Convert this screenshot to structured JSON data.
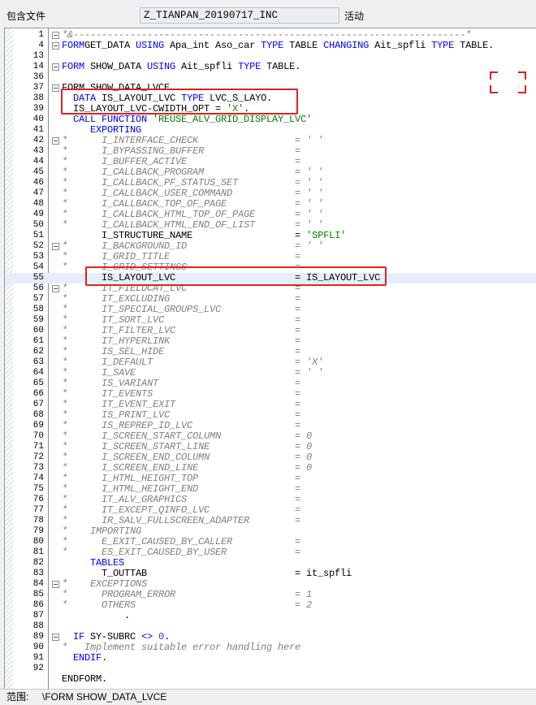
{
  "header": {
    "include_label": "包含文件",
    "program_name": "Z_TIANPAN_20190717_INC",
    "status": "活动"
  },
  "footer": {
    "scope_label": "范围:",
    "scope_value": "\\FORM SHOW_DATA_LVCE"
  },
  "editor": {
    "lines": [
      {
        "n": "1",
        "fold": true,
        "t": [
          [
            "cmt",
            "*&---------------------------------------------------------------------*"
          ]
        ]
      },
      {
        "n": "4",
        "fold": true,
        "t": [
          [
            "kw",
            "FORM"
          ],
          [
            "",
            "GET_DATA "
          ],
          [
            "kw",
            "USING"
          ],
          [
            "",
            " Apa_int Aso_car "
          ],
          [
            "kw",
            "TYPE"
          ],
          [
            "",
            " TABLE "
          ],
          [
            "kw",
            "CHANGING"
          ],
          [
            "",
            " Ait_spfli "
          ],
          [
            "kw",
            "TYPE"
          ],
          [
            "",
            " TABLE."
          ]
        ]
      },
      {
        "n": "13",
        "t": []
      },
      {
        "n": "14",
        "fold": true,
        "t": [
          [
            "kw",
            "FORM"
          ],
          [
            "",
            " SHOW_DATA "
          ],
          [
            "kw",
            "USING"
          ],
          [
            "",
            " Ait_spfli "
          ],
          [
            "kw",
            "TYPE"
          ],
          [
            "",
            " TABLE."
          ]
        ]
      },
      {
        "n": "36",
        "t": []
      },
      {
        "n": "37",
        "fold": true,
        "t": [
          [
            "",
            "FORM SHOW_DATA_LVCE."
          ]
        ]
      },
      {
        "n": "38",
        "t": [
          [
            "",
            "  "
          ],
          [
            "kw",
            "DATA"
          ],
          [
            "",
            " IS_LAYOUT_LVC "
          ],
          [
            "kw",
            "TYPE"
          ],
          [
            "",
            " LVC_S_LAYO."
          ]
        ]
      },
      {
        "n": "39",
        "t": [
          [
            "",
            "  IS_LAYOUT_LVC-CWIDTH_OPT = "
          ],
          [
            "str",
            "'X'"
          ],
          [
            "",
            "."
          ]
        ]
      },
      {
        "n": "40",
        "t": [
          [
            "",
            "  "
          ],
          [
            "kw",
            "CALL FUNCTION"
          ],
          [
            "str",
            " 'REUSE_ALV_GRID_DISPLAY_LVC'"
          ]
        ]
      },
      {
        "n": "41",
        "t": [
          [
            "kw",
            "     EXPORTING"
          ]
        ]
      },
      {
        "n": "42",
        "fold": true,
        "t": [
          [
            "cmt",
            "*      I_INTERFACE_CHECK                 = ' '"
          ]
        ]
      },
      {
        "n": "43",
        "t": [
          [
            "cmt",
            "*      I_BYPASSING_BUFFER                = "
          ]
        ]
      },
      {
        "n": "44",
        "t": [
          [
            "cmt",
            "*      I_BUFFER_ACTIVE                   = "
          ]
        ]
      },
      {
        "n": "45",
        "t": [
          [
            "cmt",
            "*      I_CALLBACK_PROGRAM                = ' '"
          ]
        ]
      },
      {
        "n": "46",
        "t": [
          [
            "cmt",
            "*      I_CALLBACK_PF_STATUS_SET          = ' '"
          ]
        ]
      },
      {
        "n": "47",
        "t": [
          [
            "cmt",
            "*      I_CALLBACK_USER_COMMAND           = ' '"
          ]
        ]
      },
      {
        "n": "48",
        "t": [
          [
            "cmt",
            "*      I_CALLBACK_TOP_OF_PAGE            = ' '"
          ]
        ]
      },
      {
        "n": "49",
        "t": [
          [
            "cmt",
            "*      I_CALLBACK_HTML_TOP_OF_PAGE       = ' '"
          ]
        ]
      },
      {
        "n": "50",
        "t": [
          [
            "cmt",
            "*      I_CALLBACK_HTML_END_OF_LIST       = ' '"
          ]
        ]
      },
      {
        "n": "51",
        "t": [
          [
            "",
            "       I_STRUCTURE_NAME                  = "
          ],
          [
            "str",
            "'SPFLI'"
          ]
        ]
      },
      {
        "n": "52",
        "fold": true,
        "t": [
          [
            "cmt",
            "*      I_BACKGROUND_ID                   = ' '"
          ]
        ]
      },
      {
        "n": "53",
        "t": [
          [
            "cmt",
            "*      I_GRID_TITLE                      = "
          ]
        ]
      },
      {
        "n": "54",
        "t": [
          [
            "cmt",
            "*      I_GRID_SETTINGS                   = "
          ]
        ]
      },
      {
        "n": "55",
        "hl": true,
        "t": [
          [
            "",
            "       IS_LAYOUT_LVC                     = IS_LAYOUT_LVC"
          ]
        ]
      },
      {
        "n": "56",
        "fold": true,
        "t": [
          [
            "cmt",
            "*      IT_FIELDCAT_LVC                   = "
          ]
        ]
      },
      {
        "n": "57",
        "t": [
          [
            "cmt",
            "*      IT_EXCLUDING                      = "
          ]
        ]
      },
      {
        "n": "58",
        "t": [
          [
            "cmt",
            "*      IT_SPECIAL_GROUPS_LVC             = "
          ]
        ]
      },
      {
        "n": "59",
        "t": [
          [
            "cmt",
            "*      IT_SORT_LVC                       = "
          ]
        ]
      },
      {
        "n": "60",
        "t": [
          [
            "cmt",
            "*      IT_FILTER_LVC                     = "
          ]
        ]
      },
      {
        "n": "61",
        "t": [
          [
            "cmt",
            "*      IT_HYPERLINK                      = "
          ]
        ]
      },
      {
        "n": "62",
        "t": [
          [
            "cmt",
            "*      IS_SEL_HIDE                       = "
          ]
        ]
      },
      {
        "n": "63",
        "t": [
          [
            "cmt",
            "*      I_DEFAULT                         = 'X'"
          ]
        ]
      },
      {
        "n": "64",
        "t": [
          [
            "cmt",
            "*      I_SAVE                            = ' '"
          ]
        ]
      },
      {
        "n": "65",
        "t": [
          [
            "cmt",
            "*      IS_VARIANT                        = "
          ]
        ]
      },
      {
        "n": "66",
        "t": [
          [
            "cmt",
            "*      IT_EVENTS                         = "
          ]
        ]
      },
      {
        "n": "67",
        "t": [
          [
            "cmt",
            "*      IT_EVENT_EXIT                     = "
          ]
        ]
      },
      {
        "n": "68",
        "t": [
          [
            "cmt",
            "*      IS_PRINT_LVC                      = "
          ]
        ]
      },
      {
        "n": "69",
        "t": [
          [
            "cmt",
            "*      IS_REPREP_ID_LVC                  = "
          ]
        ]
      },
      {
        "n": "70",
        "t": [
          [
            "cmt",
            "*      I_SCREEN_START_COLUMN             = 0"
          ]
        ]
      },
      {
        "n": "71",
        "t": [
          [
            "cmt",
            "*      I_SCREEN_START_LINE               = 0"
          ]
        ]
      },
      {
        "n": "72",
        "t": [
          [
            "cmt",
            "*      I_SCREEN_END_COLUMN               = 0"
          ]
        ]
      },
      {
        "n": "73",
        "t": [
          [
            "cmt",
            "*      I_SCREEN_END_LINE                 = 0"
          ]
        ]
      },
      {
        "n": "74",
        "t": [
          [
            "cmt",
            "*      I_HTML_HEIGHT_TOP                 = "
          ]
        ]
      },
      {
        "n": "75",
        "t": [
          [
            "cmt",
            "*      I_HTML_HEIGHT_END                 = "
          ]
        ]
      },
      {
        "n": "76",
        "t": [
          [
            "cmt",
            "*      IT_ALV_GRAPHICS                   = "
          ]
        ]
      },
      {
        "n": "77",
        "t": [
          [
            "cmt",
            "*      IT_EXCEPT_QINFO_LVC               = "
          ]
        ]
      },
      {
        "n": "78",
        "t": [
          [
            "cmt",
            "*      IR_SALV_FULLSCREEN_ADAPTER        = "
          ]
        ]
      },
      {
        "n": "79",
        "t": [
          [
            "cmt",
            "*    IMPORTING"
          ]
        ]
      },
      {
        "n": "80",
        "t": [
          [
            "cmt",
            "*      E_EXIT_CAUSED_BY_CALLER           = "
          ]
        ]
      },
      {
        "n": "81",
        "t": [
          [
            "cmt",
            "*      ES_EXIT_CAUSED_BY_USER            = "
          ]
        ]
      },
      {
        "n": "82",
        "t": [
          [
            "kw",
            "     TABLES"
          ]
        ]
      },
      {
        "n": "83",
        "t": [
          [
            "",
            "       T_OUTTAB                          = it_spfli"
          ]
        ]
      },
      {
        "n": "84",
        "fold": true,
        "t": [
          [
            "cmt",
            "*    EXCEPTIONS"
          ]
        ]
      },
      {
        "n": "85",
        "t": [
          [
            "cmt",
            "*      PROGRAM_ERROR                     = 1"
          ]
        ]
      },
      {
        "n": "86",
        "t": [
          [
            "cmt",
            "*      OTHERS                            = 2"
          ]
        ]
      },
      {
        "n": "87",
        "t": [
          [
            "",
            "           ."
          ]
        ]
      },
      {
        "n": "88",
        "t": []
      },
      {
        "n": "89",
        "fold": true,
        "t": [
          [
            "",
            "  "
          ],
          [
            "kw",
            "IF"
          ],
          [
            "",
            " SY-SUBRC "
          ],
          [
            "kw",
            "<>"
          ],
          [
            "",
            " "
          ],
          [
            "num",
            "0"
          ],
          [
            "",
            "."
          ]
        ]
      },
      {
        "n": "90",
        "t": [
          [
            "cmt",
            "*   Implement suitable error handling here"
          ]
        ]
      },
      {
        "n": "91",
        "t": [
          [
            "",
            "  "
          ],
          [
            "kw",
            "ENDIF"
          ],
          [
            "",
            "."
          ]
        ]
      },
      {
        "n": "92",
        "t": []
      },
      {
        "n": "",
        "t": [
          [
            "",
            "ENDFORM."
          ]
        ]
      }
    ]
  }
}
